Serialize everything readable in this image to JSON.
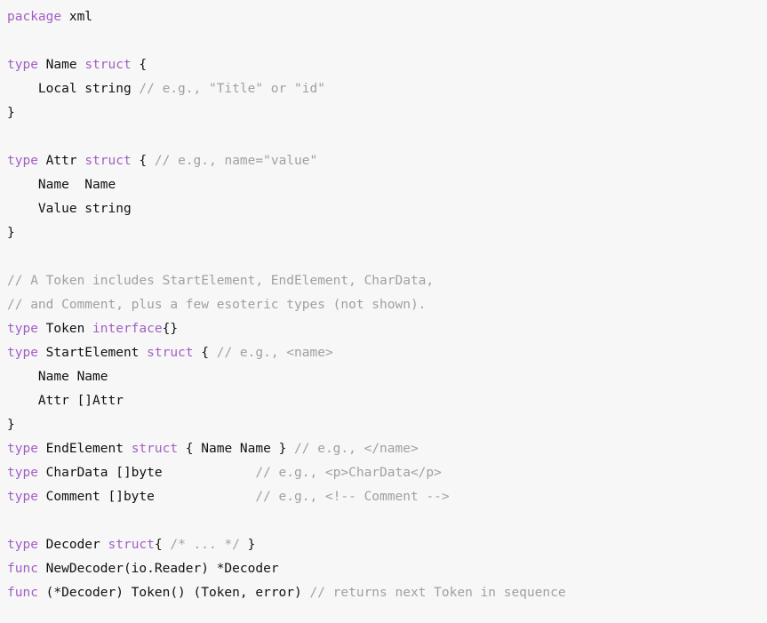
{
  "editor": {
    "language": "go",
    "package": "xml",
    "background_color": "#f7f7f7",
    "keyword_color": "#a25fc4",
    "plain_color": "#111111",
    "comment_color": "#a0a0a0"
  },
  "code": {
    "lines": [
      {
        "tokens": [
          {
            "t": "kw",
            "s": "package"
          },
          {
            "t": "plain",
            "s": " xml"
          }
        ]
      },
      {
        "tokens": []
      },
      {
        "tokens": [
          {
            "t": "kw",
            "s": "type"
          },
          {
            "t": "plain",
            "s": " Name "
          },
          {
            "t": "kw",
            "s": "struct"
          },
          {
            "t": "plain",
            "s": " {"
          }
        ]
      },
      {
        "tokens": [
          {
            "t": "plain",
            "s": "    Local string "
          },
          {
            "t": "comment",
            "s": "// e.g., \"Title\" or \"id\""
          }
        ]
      },
      {
        "tokens": [
          {
            "t": "plain",
            "s": "}"
          }
        ]
      },
      {
        "tokens": []
      },
      {
        "tokens": [
          {
            "t": "kw",
            "s": "type"
          },
          {
            "t": "plain",
            "s": " Attr "
          },
          {
            "t": "kw",
            "s": "struct"
          },
          {
            "t": "plain",
            "s": " { "
          },
          {
            "t": "comment",
            "s": "// e.g., name=\"value\""
          }
        ]
      },
      {
        "tokens": [
          {
            "t": "plain",
            "s": "    Name  Name"
          }
        ]
      },
      {
        "tokens": [
          {
            "t": "plain",
            "s": "    Value string"
          }
        ]
      },
      {
        "tokens": [
          {
            "t": "plain",
            "s": "}"
          }
        ]
      },
      {
        "tokens": []
      },
      {
        "tokens": [
          {
            "t": "comment",
            "s": "// A Token includes StartElement, EndElement, CharData,"
          }
        ]
      },
      {
        "tokens": [
          {
            "t": "comment",
            "s": "// and Comment, plus a few esoteric types (not shown)."
          }
        ]
      },
      {
        "tokens": [
          {
            "t": "kw",
            "s": "type"
          },
          {
            "t": "plain",
            "s": " Token "
          },
          {
            "t": "kw",
            "s": "interface"
          },
          {
            "t": "plain",
            "s": "{}"
          }
        ]
      },
      {
        "tokens": [
          {
            "t": "kw",
            "s": "type"
          },
          {
            "t": "plain",
            "s": " StartElement "
          },
          {
            "t": "kw",
            "s": "struct"
          },
          {
            "t": "plain",
            "s": " { "
          },
          {
            "t": "comment",
            "s": "// e.g., <name>"
          }
        ]
      },
      {
        "tokens": [
          {
            "t": "plain",
            "s": "    Name Name"
          }
        ]
      },
      {
        "tokens": [
          {
            "t": "plain",
            "s": "    Attr []Attr"
          }
        ]
      },
      {
        "tokens": [
          {
            "t": "plain",
            "s": "}"
          }
        ]
      },
      {
        "tokens": [
          {
            "t": "kw",
            "s": "type"
          },
          {
            "t": "plain",
            "s": " EndElement "
          },
          {
            "t": "kw",
            "s": "struct"
          },
          {
            "t": "plain",
            "s": " { Name Name } "
          },
          {
            "t": "comment",
            "s": "// e.g., </name>"
          }
        ]
      },
      {
        "tokens": [
          {
            "t": "kw",
            "s": "type"
          },
          {
            "t": "plain",
            "s": " CharData []byte            "
          },
          {
            "t": "comment",
            "s": "// e.g., <p>CharData</p>"
          }
        ]
      },
      {
        "tokens": [
          {
            "t": "kw",
            "s": "type"
          },
          {
            "t": "plain",
            "s": " Comment []byte             "
          },
          {
            "t": "comment",
            "s": "// e.g., <!-- Comment -->"
          }
        ]
      },
      {
        "tokens": []
      },
      {
        "tokens": [
          {
            "t": "kw",
            "s": "type"
          },
          {
            "t": "plain",
            "s": " Decoder "
          },
          {
            "t": "kw",
            "s": "struct"
          },
          {
            "t": "plain",
            "s": "{ "
          },
          {
            "t": "comment",
            "s": "/* ... */"
          },
          {
            "t": "plain",
            "s": " }"
          }
        ]
      },
      {
        "tokens": [
          {
            "t": "kw",
            "s": "func"
          },
          {
            "t": "plain",
            "s": " NewDecoder(io.Reader) *Decoder"
          }
        ]
      },
      {
        "tokens": [
          {
            "t": "kw",
            "s": "func"
          },
          {
            "t": "plain",
            "s": " (*Decoder) Token() (Token, error) "
          },
          {
            "t": "comment",
            "s": "// returns next Token in sequence"
          }
        ]
      }
    ]
  }
}
